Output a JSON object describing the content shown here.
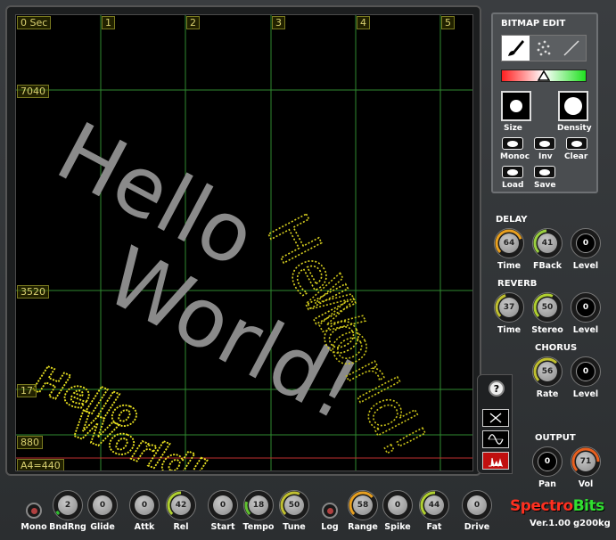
{
  "display": {
    "time_labels": [
      "0 Sec",
      "1",
      "2",
      "3",
      "4",
      "5"
    ],
    "freq_labels": [
      "7040",
      "3520",
      "17",
      "880",
      "A4=440"
    ],
    "big_text_line1": "Hello",
    "big_text_line2": "World!",
    "yellow_text_line1": "Hello",
    "yellow_text_line2": "World!",
    "mid_text_line1": "Hello",
    "mid_text_line2": "World!"
  },
  "bitmap_edit": {
    "title": "BITMAP EDIT",
    "tools": [
      "brush-icon",
      "spray-icon",
      "line-icon"
    ],
    "size_label": "Size",
    "density_label": "Density",
    "buttons": [
      {
        "label": "Monoc"
      },
      {
        "label": "Inv"
      },
      {
        "label": "Clear"
      },
      {
        "label": "Load"
      },
      {
        "label": "Save"
      }
    ]
  },
  "delay": {
    "title": "DELAY",
    "knobs": [
      {
        "label": "Time",
        "value": "64"
      },
      {
        "label": "FBack",
        "value": "41"
      },
      {
        "label": "Level",
        "value": "0"
      }
    ]
  },
  "reverb": {
    "title": "REVERB",
    "knobs": [
      {
        "label": "Time",
        "value": "37"
      },
      {
        "label": "Stereo",
        "value": "50"
      },
      {
        "label": "Level",
        "value": "0"
      }
    ]
  },
  "chorus": {
    "title": "CHORUS",
    "knobs": [
      {
        "label": "Rate",
        "value": "56"
      },
      {
        "label": "Level",
        "value": "0"
      }
    ]
  },
  "output": {
    "title": "OUTPUT",
    "knobs": [
      {
        "label": "Pan",
        "value": "0"
      },
      {
        "label": "Vol",
        "value": "71"
      }
    ]
  },
  "side_tools": {
    "help": "?"
  },
  "bottom": {
    "mono_label": "Mono",
    "log_label": "Log",
    "knobs": [
      {
        "label": "BndRng",
        "value": "2"
      },
      {
        "label": "Glide",
        "value": "0"
      },
      {
        "label": "Attk",
        "value": "0"
      },
      {
        "label": "Rel",
        "value": "42"
      },
      {
        "label": "Start",
        "value": "0"
      },
      {
        "label": "Tempo",
        "value": "18"
      },
      {
        "label": "Tune",
        "value": "50"
      },
      {
        "label": "Range",
        "value": "58"
      },
      {
        "label": "Spike",
        "value": "0"
      },
      {
        "label": "Fat",
        "value": "44"
      },
      {
        "label": "Drive",
        "value": "0"
      }
    ]
  },
  "logo": {
    "name_part1": "Spectro",
    "name_part2": "Bits",
    "version": "Ver.1.00",
    "author": "g200kg"
  },
  "colors": {
    "accent_yellow": "#e8e020",
    "grid_green": "#2f8a2f",
    "logo_red": "#ff3020",
    "logo_green": "#30e030"
  }
}
